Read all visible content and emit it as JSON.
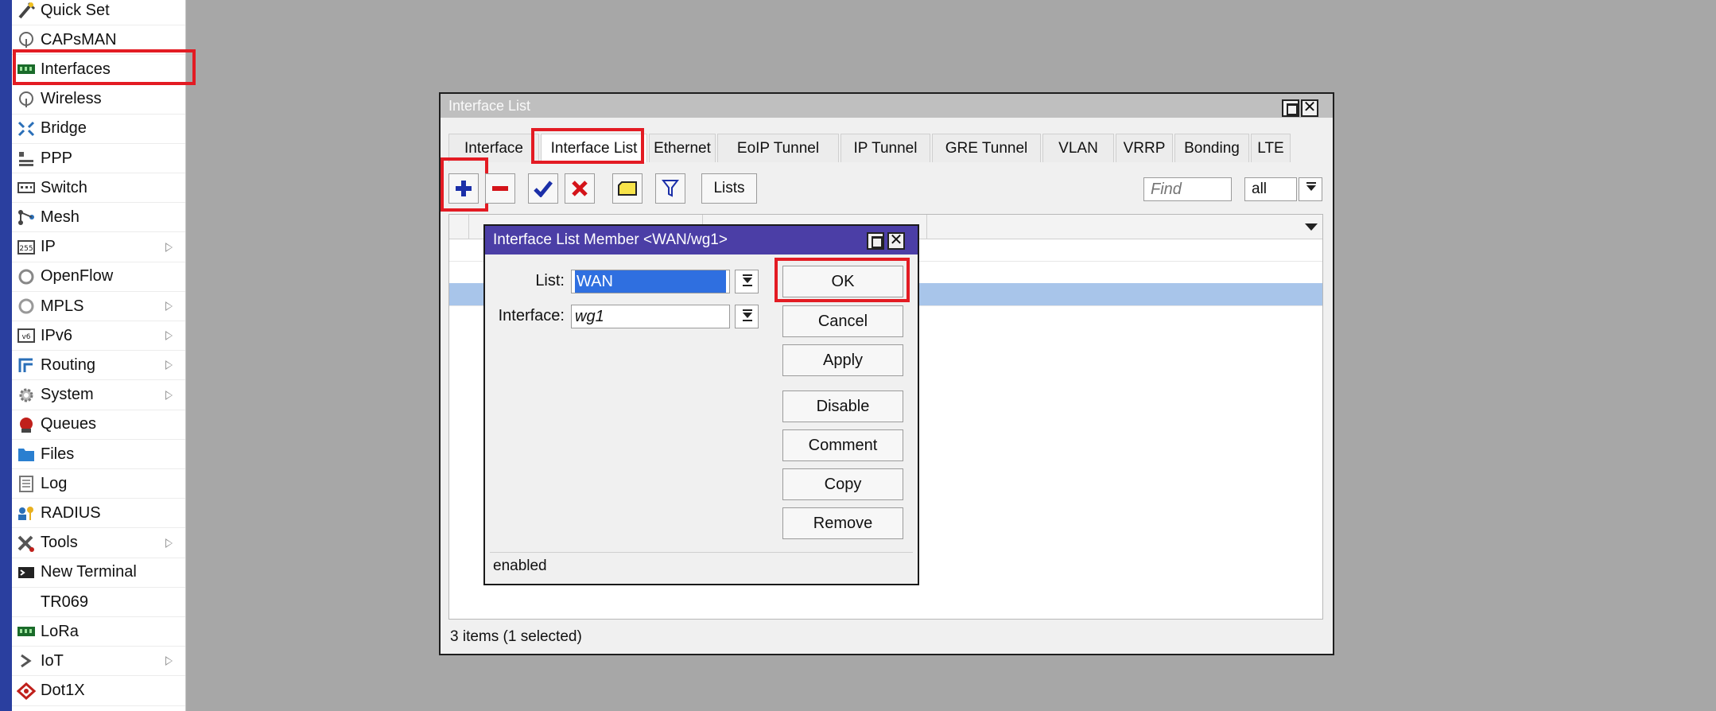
{
  "sidebar": {
    "items": [
      {
        "label": "Quick Set",
        "icon": "wand-icon",
        "submenu": false
      },
      {
        "label": "CAPsMAN",
        "icon": "antenna-icon",
        "submenu": false
      },
      {
        "label": "Interfaces",
        "icon": "interfaces-icon",
        "submenu": false,
        "highlighted": true
      },
      {
        "label": "Wireless",
        "icon": "wireless-icon",
        "submenu": false
      },
      {
        "label": "Bridge",
        "icon": "bridge-icon",
        "submenu": false
      },
      {
        "label": "PPP",
        "icon": "ppp-icon",
        "submenu": false
      },
      {
        "label": "Switch",
        "icon": "switch-icon",
        "submenu": false
      },
      {
        "label": "Mesh",
        "icon": "mesh-icon",
        "submenu": false
      },
      {
        "label": "IP",
        "icon": "ip-icon",
        "submenu": true
      },
      {
        "label": "OpenFlow",
        "icon": "openflow-icon",
        "submenu": false
      },
      {
        "label": "MPLS",
        "icon": "mpls-icon",
        "submenu": true
      },
      {
        "label": "IPv6",
        "icon": "ipv6-icon",
        "submenu": true
      },
      {
        "label": "Routing",
        "icon": "routing-icon",
        "submenu": true
      },
      {
        "label": "System",
        "icon": "system-gear-icon",
        "submenu": true
      },
      {
        "label": "Queues",
        "icon": "queues-icon",
        "submenu": false
      },
      {
        "label": "Files",
        "icon": "folder-icon",
        "submenu": false
      },
      {
        "label": "Log",
        "icon": "log-icon",
        "submenu": false
      },
      {
        "label": "RADIUS",
        "icon": "radius-icon",
        "submenu": false
      },
      {
        "label": "Tools",
        "icon": "tools-icon",
        "submenu": true
      },
      {
        "label": "New Terminal",
        "icon": "terminal-icon",
        "submenu": false
      },
      {
        "label": "TR069",
        "icon": "",
        "submenu": false
      },
      {
        "label": "LoRa",
        "icon": "lora-icon",
        "submenu": false
      },
      {
        "label": "IoT",
        "icon": "iot-icon",
        "submenu": true
      },
      {
        "label": "Dot1X",
        "icon": "dot1x-icon",
        "submenu": false
      }
    ]
  },
  "window": {
    "title": "Interface List",
    "tabs": [
      {
        "label": "Interface",
        "active": false
      },
      {
        "label": "Interface List",
        "active": true
      },
      {
        "label": "Ethernet",
        "active": false
      },
      {
        "label": "EoIP Tunnel",
        "active": false
      },
      {
        "label": "IP Tunnel",
        "active": false
      },
      {
        "label": "GRE Tunnel",
        "active": false
      },
      {
        "label": "VLAN",
        "active": false
      },
      {
        "label": "VRRP",
        "active": false
      },
      {
        "label": "Bonding",
        "active": false
      },
      {
        "label": "LTE",
        "active": false
      }
    ],
    "toolbar": {
      "lists_label": "Lists",
      "find_placeholder": "Find",
      "filter_value": "all"
    },
    "status": "3 items (1 selected)"
  },
  "dialog": {
    "title": "Interface List Member <WAN/wg1>",
    "fields": {
      "list_label": "List:",
      "list_value": "WAN",
      "interface_label": "Interface:",
      "interface_value": "wg1"
    },
    "buttons": {
      "ok": "OK",
      "cancel": "Cancel",
      "apply": "Apply",
      "disable": "Disable",
      "comment": "Comment",
      "copy": "Copy",
      "remove": "Remove"
    },
    "status": "enabled"
  },
  "colors": {
    "highlight": "#e31b23",
    "dialog_title": "#4b3ea6",
    "selection": "#a8c5ea"
  }
}
